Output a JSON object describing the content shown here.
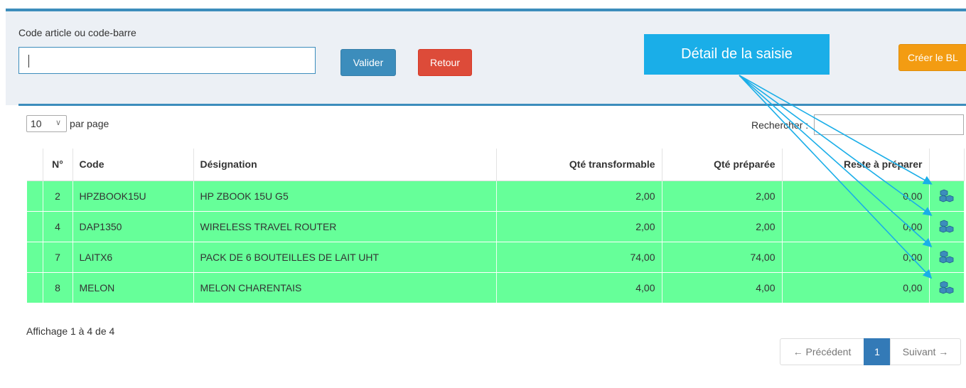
{
  "form": {
    "code_label": "Code article ou code-barre",
    "code_value": "",
    "valider_label": "Valider",
    "retour_label": "Retour",
    "creer_label": "Créer le BL"
  },
  "annotation": {
    "text": "Détail de la saisie"
  },
  "table_controls": {
    "page_length": "10",
    "page_length_suffix": "par page",
    "search_label": "Rechercher :",
    "search_value": ""
  },
  "table": {
    "columns": [
      "N°",
      "Code",
      "Désignation",
      "Qté transformable",
      "Qté préparée",
      "Reste à préparer",
      ""
    ],
    "rows": [
      {
        "n": "2",
        "code": "HPZBOOK15U",
        "designation": "HP ZBOOK 15U G5",
        "qte_transformable": "2,00",
        "qte_preparee": "2,00",
        "reste": "0,00"
      },
      {
        "n": "4",
        "code": "DAP1350",
        "designation": "WIRELESS TRAVEL ROUTER",
        "qte_transformable": "2,00",
        "qte_preparee": "2,00",
        "reste": "0,00"
      },
      {
        "n": "7",
        "code": "LAITX6",
        "designation": "PACK DE 6 BOUTEILLES DE LAIT UHT",
        "qte_transformable": "74,00",
        "qte_preparee": "74,00",
        "reste": "0,00"
      },
      {
        "n": "8",
        "code": "MELON",
        "designation": "MELON CHARENTAIS",
        "qte_transformable": "4,00",
        "qte_preparee": "4,00",
        "reste": "0,00"
      }
    ],
    "row_icon": "cubes-icon",
    "row_color": "#66ff99"
  },
  "footer": {
    "info": "Affichage 1 à 4 de 4",
    "prev_label": "← Précédent",
    "current_page": "1",
    "next_label": "Suivant →"
  },
  "colors": {
    "primary": "#3c8dbc",
    "danger": "#dd4b39",
    "warning": "#f39c12",
    "annotation": "#1aaee8",
    "row_highlight": "#66ff99"
  }
}
